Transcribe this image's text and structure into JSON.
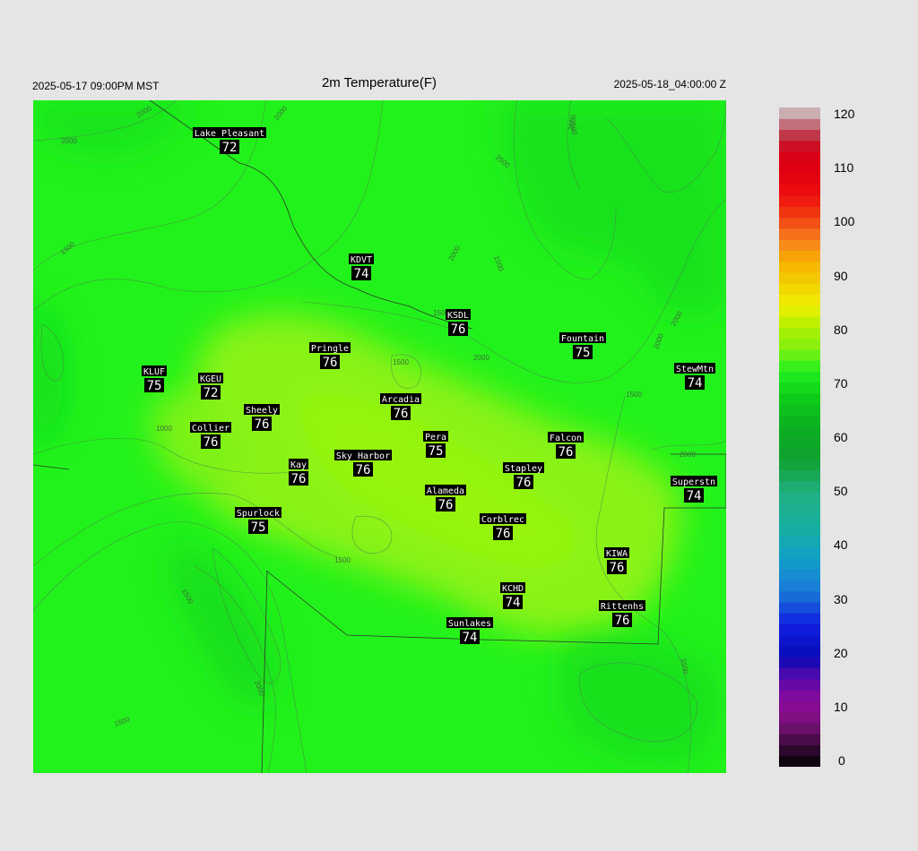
{
  "header": {
    "local_time": "2025-05-17 09:00PM MST",
    "title": "2m Temperature(F)",
    "utc_time": "2025-05-18_04:00:00 Z"
  },
  "colorbar": {
    "min": 0,
    "max": 120,
    "labels": [
      "120",
      "110",
      "100",
      "90",
      "80",
      "70",
      "60",
      "50",
      "40",
      "30",
      "20",
      "10",
      "0"
    ]
  },
  "stations": [
    {
      "name": "Lake Pleasant",
      "value": "72"
    },
    {
      "name": "KDVT",
      "value": "74"
    },
    {
      "name": "KSDL",
      "value": "76"
    },
    {
      "name": "Fountain",
      "value": "75"
    },
    {
      "name": "Pringle",
      "value": "76"
    },
    {
      "name": "StewMtn",
      "value": "74"
    },
    {
      "name": "KLUF",
      "value": "75"
    },
    {
      "name": "KGEU",
      "value": "72"
    },
    {
      "name": "Arcadia",
      "value": "76"
    },
    {
      "name": "Sheely",
      "value": "76"
    },
    {
      "name": "Collier",
      "value": "76"
    },
    {
      "name": "Pera",
      "value": "75"
    },
    {
      "name": "Falcon",
      "value": "76"
    },
    {
      "name": "Sky Harbor",
      "value": "76"
    },
    {
      "name": "Kay",
      "value": "76"
    },
    {
      "name": "Stapley",
      "value": "76"
    },
    {
      "name": "Superstn",
      "value": "74"
    },
    {
      "name": "Alameda",
      "value": "76"
    },
    {
      "name": "Spurlock",
      "value": "75"
    },
    {
      "name": "Corblrec",
      "value": "76"
    },
    {
      "name": "KIWA",
      "value": "76"
    },
    {
      "name": "KCHD",
      "value": "74"
    },
    {
      "name": "Rittenhs",
      "value": "76"
    },
    {
      "name": "Sunlakes",
      "value": "74"
    }
  ],
  "contour_labels": [
    "2000",
    "2000",
    "2000",
    "1500",
    "2000",
    "1500",
    "1500",
    "1500",
    "1000",
    "1500",
    "1500",
    "1500",
    "2000",
    "2000",
    "2000",
    "1500",
    "2000",
    "1500",
    "2500",
    "2500",
    "2500",
    "2000"
  ],
  "colors": {
    "background": "#e5e5e5",
    "field_base": "#1ef01e",
    "field_warm": "#8cf014",
    "label_box": "#000000",
    "label_text": "#ffffff"
  }
}
